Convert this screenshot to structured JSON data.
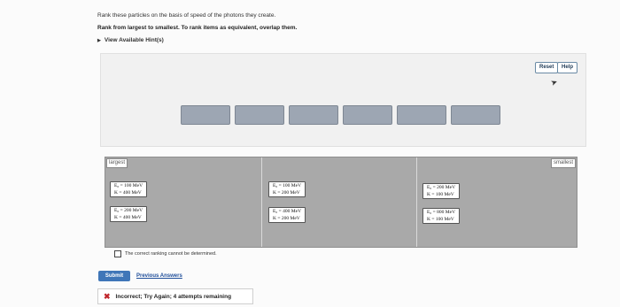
{
  "instructions": {
    "line1": "Rank these particles on the basis of speed of the photons they create.",
    "line2": "Rank from largest to smallest. To rank items as equivalent, overlap them.",
    "hints": "View Available Hint(s)"
  },
  "toolbar": {
    "reset": "Reset",
    "help": "Help"
  },
  "ranking": {
    "largest_label": "largest",
    "smallest_label": "smallest",
    "items": [
      {
        "line1": "E₀ = 100 MeV",
        "line2": "K = 400 MeV"
      },
      {
        "line1": "E₀ = 200 MeV",
        "line2": "K = 400 MeV"
      },
      {
        "line1": "E₀ = 100 MeV",
        "line2": "K = 200 MeV"
      },
      {
        "line1": "E₀ = 400 MeV",
        "line2": "K = 200 MeV"
      },
      {
        "line1": "E₀ = 200 MeV",
        "line2": "K = 100 MeV"
      },
      {
        "line1": "E₀ = 800 MeV",
        "line2": "K = 100 MeV"
      }
    ]
  },
  "checkbox_label": "The correct ranking cannot be determined.",
  "actions": {
    "submit": "Submit",
    "previous_answers": "Previous Answers"
  },
  "feedback": {
    "text": "Incorrect; Try Again; 4 attempts remaining"
  }
}
